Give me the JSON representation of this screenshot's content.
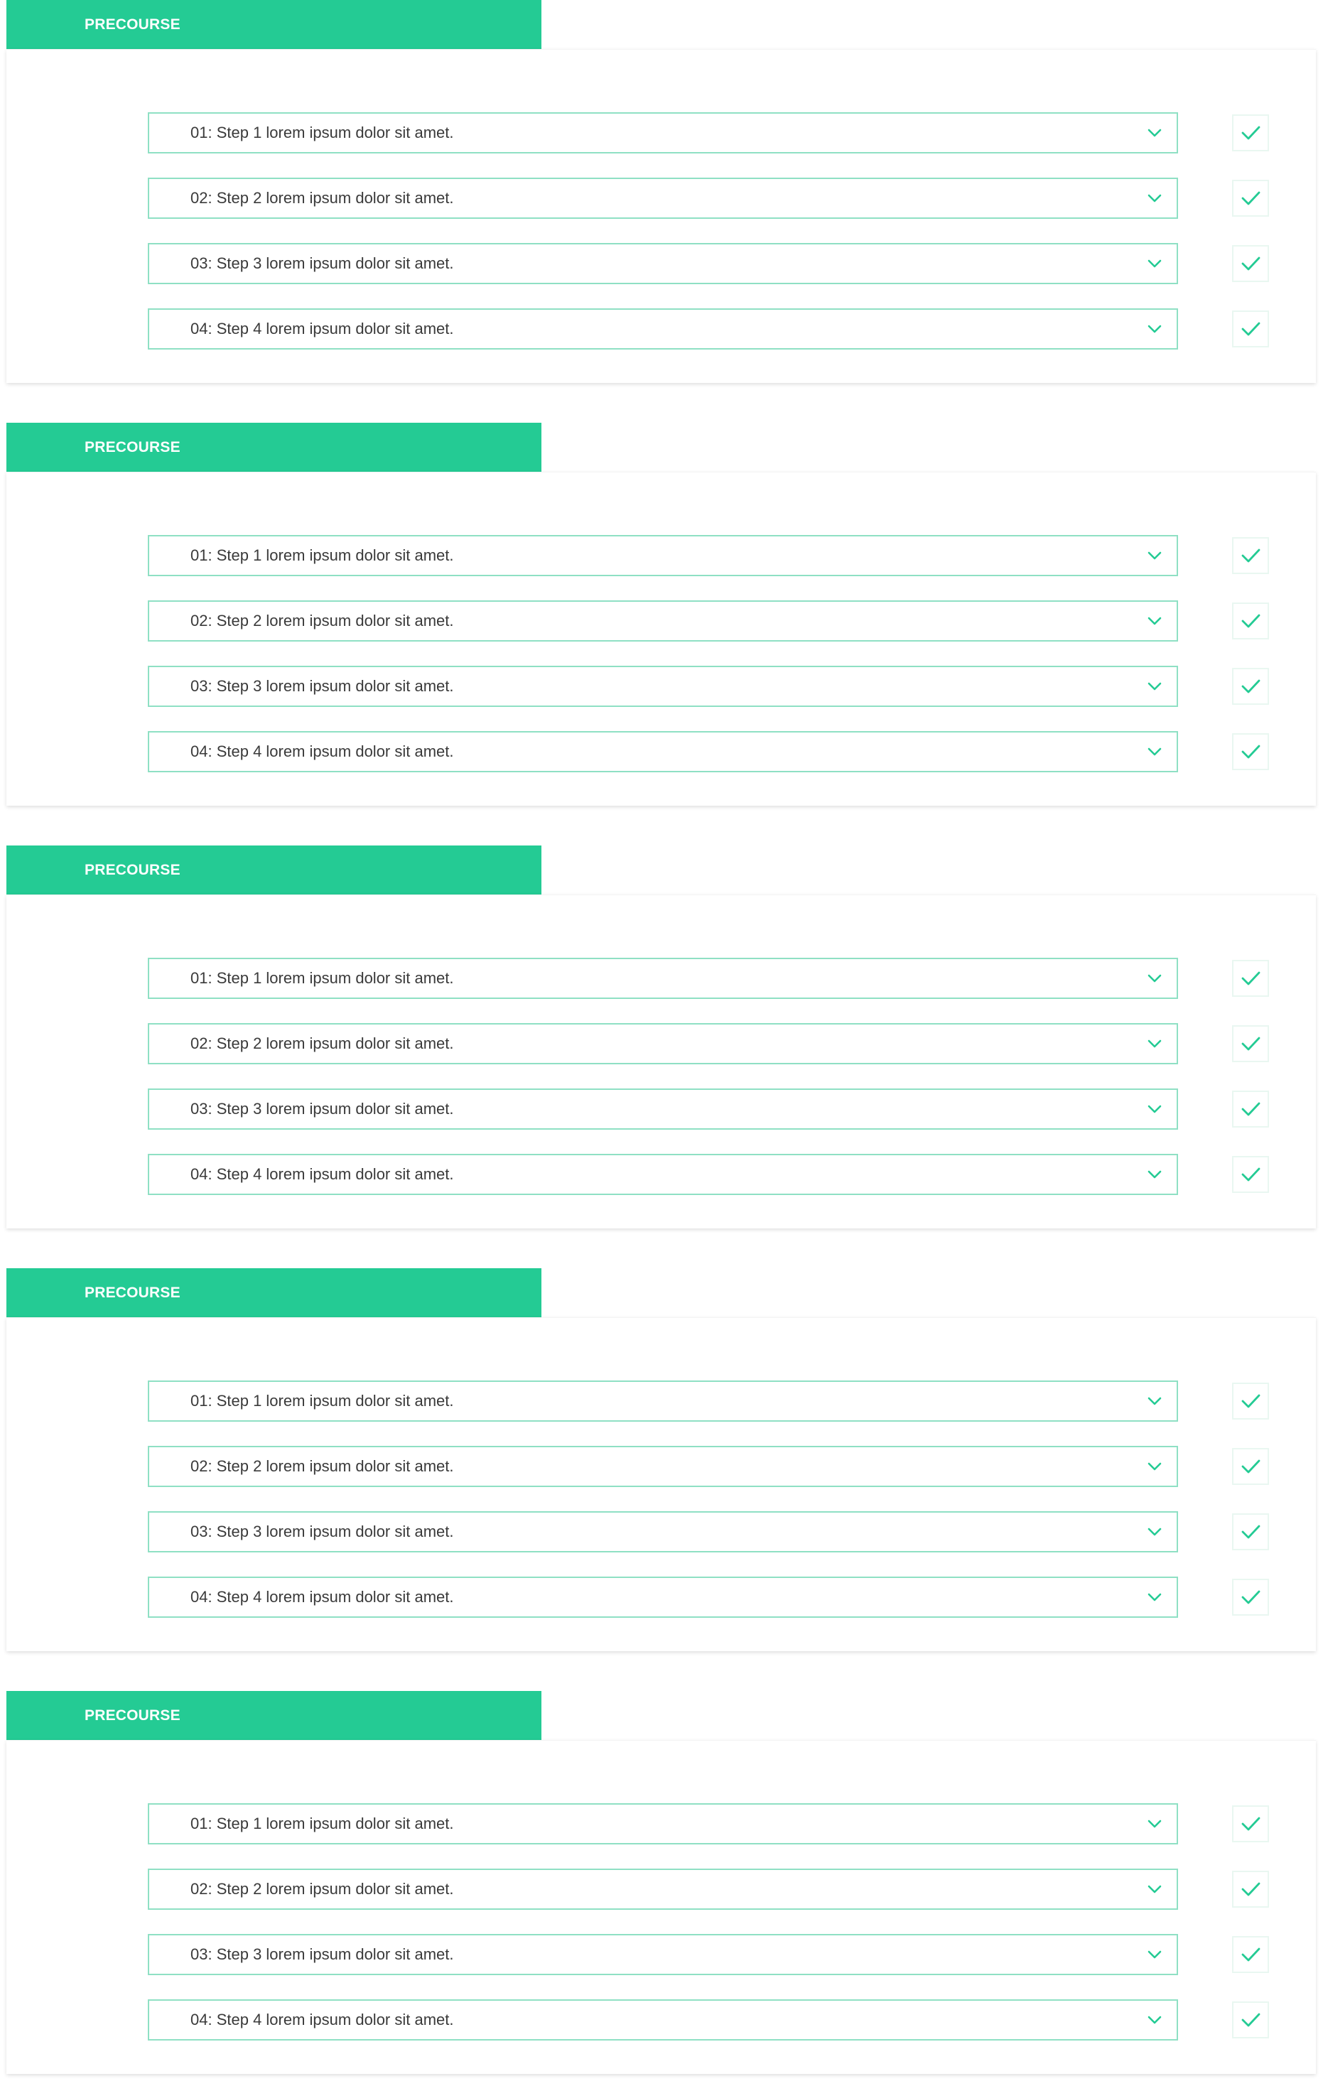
{
  "colors": {
    "accent": "#24cb94",
    "dropdown_border": "#8fe0c4",
    "check_border": "#e9f7f1",
    "text": "#3a3a3a"
  },
  "sections": [
    {
      "title": "PRECOURSE",
      "steps": [
        {
          "label": "01: Step 1 lorem ipsum dolor sit amet.",
          "checked": true
        },
        {
          "label": "02: Step 2 lorem ipsum dolor sit amet.",
          "checked": true
        },
        {
          "label": "03: Step 3 lorem ipsum dolor sit amet.",
          "checked": true
        },
        {
          "label": "04: Step 4 lorem ipsum dolor sit amet.",
          "checked": true
        }
      ]
    },
    {
      "title": "PRECOURSE",
      "steps": [
        {
          "label": "01: Step 1 lorem ipsum dolor sit amet.",
          "checked": true
        },
        {
          "label": "02: Step 2 lorem ipsum dolor sit amet.",
          "checked": true
        },
        {
          "label": "03: Step 3 lorem ipsum dolor sit amet.",
          "checked": true
        },
        {
          "label": "04: Step 4 lorem ipsum dolor sit amet.",
          "checked": true
        }
      ]
    },
    {
      "title": "PRECOURSE",
      "steps": [
        {
          "label": "01: Step 1 lorem ipsum dolor sit amet.",
          "checked": true
        },
        {
          "label": "02: Step 2 lorem ipsum dolor sit amet.",
          "checked": true
        },
        {
          "label": "03: Step 3 lorem ipsum dolor sit amet.",
          "checked": true
        },
        {
          "label": "04: Step 4 lorem ipsum dolor sit amet.",
          "checked": true
        }
      ]
    },
    {
      "title": "PRECOURSE",
      "steps": [
        {
          "label": "01: Step 1 lorem ipsum dolor sit amet.",
          "checked": true
        },
        {
          "label": "02: Step 2 lorem ipsum dolor sit amet.",
          "checked": true
        },
        {
          "label": "03: Step 3 lorem ipsum dolor sit amet.",
          "checked": true
        },
        {
          "label": "04: Step 4 lorem ipsum dolor sit amet.",
          "checked": true
        }
      ]
    },
    {
      "title": "PRECOURSE",
      "steps": [
        {
          "label": "01: Step 1 lorem ipsum dolor sit amet.",
          "checked": true
        },
        {
          "label": "02: Step 2 lorem ipsum dolor sit amet.",
          "checked": true
        },
        {
          "label": "03: Step 3 lorem ipsum dolor sit amet.",
          "checked": true
        },
        {
          "label": "04: Step 4 lorem ipsum dolor sit amet.",
          "checked": true
        }
      ]
    }
  ]
}
